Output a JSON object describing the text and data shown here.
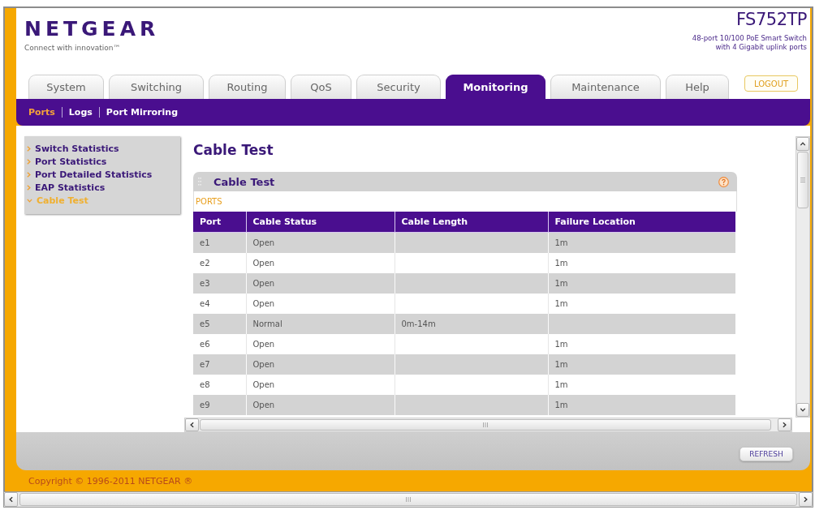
{
  "header": {
    "logo": "NETGEAR",
    "tagline": "Connect with innovation™",
    "model": "FS752TP",
    "model_description": [
      "48-port 10/100 PoE Smart Switch",
      "with 4 Gigabit uplink ports"
    ]
  },
  "tabs": [
    {
      "label": "System",
      "selected": false
    },
    {
      "label": "Switching",
      "selected": false
    },
    {
      "label": "Routing",
      "selected": false
    },
    {
      "label": "QoS",
      "selected": false
    },
    {
      "label": "Security",
      "selected": false
    },
    {
      "label": "Monitoring",
      "selected": true
    },
    {
      "label": "Maintenance",
      "selected": false
    },
    {
      "label": "Help",
      "selected": false
    }
  ],
  "logout_button": "LOGOUT",
  "subnav": [
    {
      "label": "Ports",
      "selected": true
    },
    {
      "label": "Logs",
      "selected": false
    },
    {
      "label": "Port Mirroring",
      "selected": false
    }
  ],
  "sidebar": {
    "items": [
      {
        "label": "Switch Statistics",
        "selected": false
      },
      {
        "label": "Port Statistics",
        "selected": false
      },
      {
        "label": "Port Detailed Statistics",
        "selected": false
      },
      {
        "label": "EAP Statistics",
        "selected": false
      },
      {
        "label": "Cable Test",
        "selected": true
      }
    ]
  },
  "page_title": "Cable Test",
  "panel": {
    "title": "Cable Test",
    "section": "PORTS",
    "table": {
      "columns": [
        "Port",
        "Cable Status",
        "Cable Length",
        "Failure Location"
      ],
      "rows": [
        {
          "port": "e1",
          "cable_status": "Open",
          "failure_location": "1m"
        },
        {
          "port": "e2",
          "cable_status": "Open",
          "failure_location": "1m"
        },
        {
          "port": "e3",
          "cable_status": "Open",
          "failure_location": "1m"
        },
        {
          "port": "e4",
          "cable_status": "Open",
          "failure_location": "1m"
        },
        {
          "port": "e5",
          "cable_status": "Normal",
          "cable_length": "0m-14m"
        },
        {
          "port": "e6",
          "cable_status": "Open",
          "failure_location": "1m"
        },
        {
          "port": "e7",
          "cable_status": "Open",
          "failure_location": "1m"
        },
        {
          "port": "e8",
          "cable_status": "Open",
          "failure_location": "1m"
        },
        {
          "port": "e9",
          "cable_status": "Open",
          "failure_location": "1m"
        }
      ]
    }
  },
  "refresh_button": "REFRESH",
  "footer": "Copyright © 1996-2011 NETGEAR ®"
}
